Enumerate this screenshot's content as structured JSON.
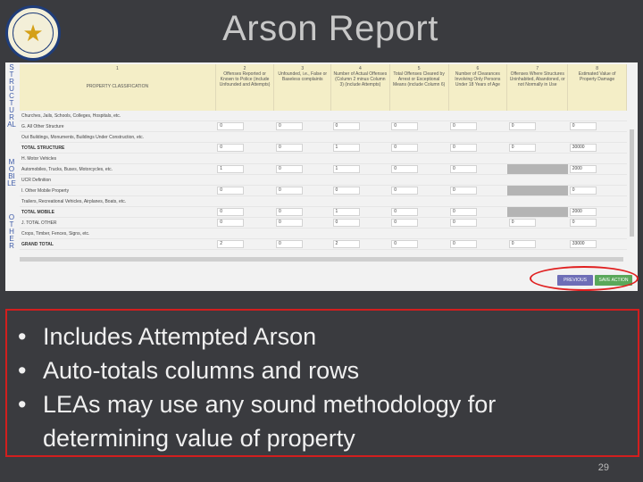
{
  "slide": {
    "title": "Arson Report",
    "page_number": "29"
  },
  "side_labels": [
    "STRUCTURAL",
    "MOBILE",
    "OTHER"
  ],
  "table": {
    "headers": [
      {
        "num": "1",
        "label": "PROPERTY CLASSIFICATION"
      },
      {
        "num": "2",
        "label": "Offenses Reported or Known to Police (include Unfounded and Attempts)"
      },
      {
        "num": "3",
        "label": "Unfounded, i.e., False or Baseless complaints"
      },
      {
        "num": "4",
        "label": "Number of Actual Offenses (Column 2 minus Column 3) (include Attempts)"
      },
      {
        "num": "5",
        "label": "Total Offenses Cleared by Arrest or Exceptional Means (include Column 6)"
      },
      {
        "num": "6",
        "label": "Number of Clearances Involving Only Persons Under 18 Years of Age"
      },
      {
        "num": "7",
        "label": "Offenses Where Structures Uninhabited, Abandoned, or not Normally in Use"
      },
      {
        "num": "8",
        "label": "Estimated Value of Property Damage"
      }
    ],
    "rows": [
      {
        "label": "Churches, Jails, Schools, Colleges, Hospitals, etc.",
        "values": [
          "",
          "",
          "",
          "",
          "",
          "",
          ""
        ],
        "total": false,
        "blank": true
      },
      {
        "label": "G. All Other Structure",
        "values": [
          "0",
          "0",
          "0",
          "0",
          "0",
          "0",
          "0"
        ],
        "total": false
      },
      {
        "label": "Out Buildings, Monuments, Buildings Under Construction, etc.",
        "values": [
          "",
          "",
          "",
          "",
          "",
          "",
          ""
        ],
        "total": false,
        "blank": true
      },
      {
        "label": "TOTAL STRUCTURE",
        "values": [
          "0",
          "0",
          "1",
          "0",
          "0",
          "0",
          "30000"
        ],
        "total": true
      },
      {
        "label": "H. Motor Vehicles",
        "values": [
          "",
          "",
          "",
          "",
          "",
          "",
          ""
        ],
        "total": false,
        "blank": true
      },
      {
        "label": "Automobiles, Trucks, Buses, Motorcycles, etc.",
        "values": [
          "1",
          "0",
          "1",
          "0",
          "0",
          "",
          "2000"
        ],
        "total": false,
        "gray": true
      },
      {
        "label": "UCR Definition",
        "values": [
          "",
          "",
          "",
          "",
          "",
          "",
          ""
        ],
        "total": false,
        "blank": true
      },
      {
        "label": "I. Other Mobile Property",
        "values": [
          "0",
          "0",
          "0",
          "0",
          "0",
          "",
          "0"
        ],
        "total": false,
        "gray": true
      },
      {
        "label": "Trailers, Recreational Vehicles, Airplanes, Boats, etc.",
        "values": [
          "",
          "",
          "",
          "",
          "",
          "",
          ""
        ],
        "total": false,
        "blank": true
      },
      {
        "label": "TOTAL MOBILE",
        "values": [
          "0",
          "0",
          "1",
          "0",
          "0",
          "",
          "2000"
        ],
        "total": true,
        "gray": true
      },
      {
        "label": "J. TOTAL OTHER",
        "values": [
          "0",
          "0",
          "0",
          "0",
          "0",
          "0",
          "0"
        ],
        "total": false
      },
      {
        "label": "Crops, Timber, Fences, Signs, etc.",
        "values": [
          "",
          "",
          "",
          "",
          "",
          "",
          ""
        ],
        "total": false,
        "blank": true
      },
      {
        "label": "GRAND TOTAL",
        "values": [
          "2",
          "0",
          "2",
          "0",
          "0",
          "0",
          "33000"
        ],
        "total": true
      }
    ]
  },
  "buttons": {
    "previous": "PREVIOUS",
    "save": "SAVE ACTION"
  },
  "bullets": [
    "Includes Attempted Arson",
    "Auto-totals columns and rows",
    "LEAs may use any sound methodology for determining value of property"
  ],
  "colors": {
    "background": "#3a3b3f",
    "header_bg": "#f4eec7",
    "highlight_red": "#d21e1e",
    "prev_button": "#6e6eb7",
    "save_button": "#5aa85a"
  }
}
